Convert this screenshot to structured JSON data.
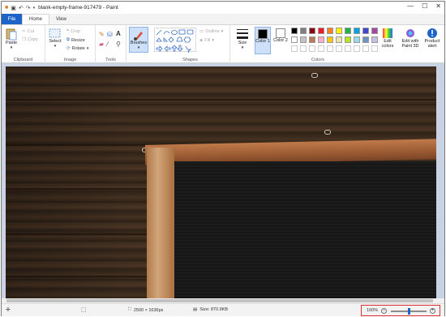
{
  "window": {
    "title": "blank-empty-frame-917479 - Paint",
    "minimize": "—",
    "maximize": "☐",
    "close": "✕"
  },
  "tabs": {
    "file": "File",
    "home": "Home",
    "view": "View"
  },
  "ribbon": {
    "clipboard": {
      "group": "Clipboard",
      "paste": "Paste",
      "cut": "Cut",
      "copy": "Copy"
    },
    "image": {
      "group": "Image",
      "select": "Select",
      "crop": "Crop",
      "resize": "Resize",
      "rotate": "Rotate"
    },
    "tools": {
      "group": "Tools"
    },
    "brushes": {
      "label": "Brushes"
    },
    "shapes": {
      "group": "Shapes",
      "outline": "Outline",
      "fill": "Fill"
    },
    "size": {
      "label": "Size"
    },
    "colors": {
      "group": "Colors",
      "color1": "Color 1",
      "color2": "Color 2",
      "edit_colors": "Edit colors",
      "edit_paint3d": "Edit with Paint 3D",
      "product_alert": "Product alert",
      "palette_row1": [
        "#000000",
        "#7f7f7f",
        "#880015",
        "#ed1c24",
        "#ff7f27",
        "#fff200",
        "#22b14c",
        "#00a2e8",
        "#3f48cc",
        "#a349a4"
      ],
      "palette_row2": [
        "#ffffff",
        "#c3c3c3",
        "#b97a57",
        "#ffaec9",
        "#ffc90e",
        "#efe4b0",
        "#b5e61d",
        "#99d9ea",
        "#7092be",
        "#c8bfe7"
      ]
    }
  },
  "status": {
    "dimensions": "2500 × 1636px",
    "size": "Size: 870.9KB",
    "zoom": "100%",
    "zoom_slider_fraction": 0.5
  }
}
